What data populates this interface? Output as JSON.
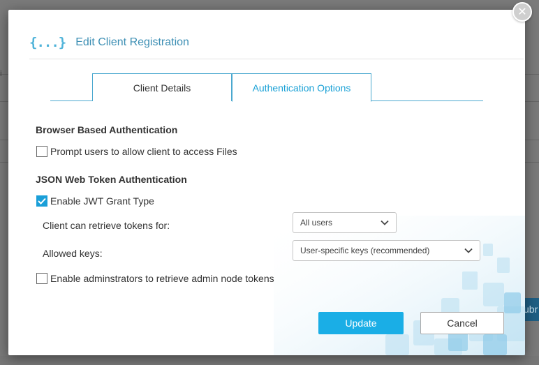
{
  "background": {
    "fragment_text": "i",
    "submit_fragment": "ubr"
  },
  "modal": {
    "title": "Edit Client Registration",
    "header_icon_glyph": "{...}",
    "close_glyph": "✕",
    "tabs": [
      {
        "label": "Client Details",
        "active": false
      },
      {
        "label": "Authentication Options",
        "active": true
      }
    ],
    "browser_auth": {
      "title": "Browser Based Authentication",
      "prompt_label": "Prompt users to allow client to access Files",
      "prompt_checked": false
    },
    "jwt_auth": {
      "title": "JSON Web Token Authentication",
      "enable_label": "Enable JWT Grant Type",
      "enable_checked": true,
      "retrieve_label": "Client can retrieve tokens for:",
      "retrieve_value": "All users",
      "keys_label": "Allowed keys:",
      "keys_value": "User-specific keys (recommended)",
      "admin_label": "Enable adminstrators to retrieve admin node tokens",
      "admin_checked": false
    },
    "buttons": {
      "update": "Update",
      "cancel": "Cancel"
    }
  },
  "colors": {
    "accent": "#1aaee6",
    "tab_border": "#4aa8cf",
    "title": "#3d8fb4"
  }
}
